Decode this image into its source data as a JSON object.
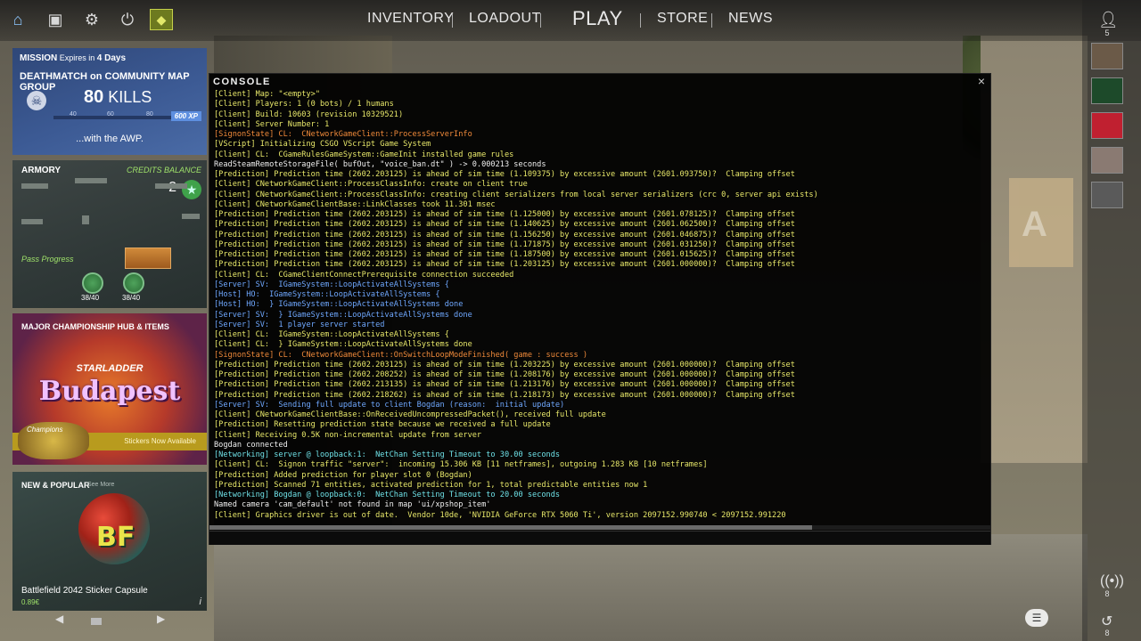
{
  "topbar": {
    "nav": [
      "INVENTORY",
      "LOADOUT",
      "PLAY",
      "STORE",
      "NEWS"
    ],
    "icons": [
      "home-icon",
      "briefcase-icon",
      "gear-icon",
      "power-icon",
      "rank-badge-icon"
    ]
  },
  "right_sidebar": {
    "friends_count": "5",
    "signal_count": "8",
    "history_count": "8"
  },
  "mission": {
    "label": "MISSION",
    "expires_prefix": "Expires in",
    "expires_value": "4 Days",
    "title": "DEATHMATCH on COMMUNITY MAP GROUP",
    "kills_number": "80",
    "kills_label": "KILLS",
    "ticks": [
      "40",
      "60",
      "80"
    ],
    "xp": "600 XP",
    "subtitle": "...with the AWP."
  },
  "armory": {
    "label": "ARMORY",
    "credits_label": "CREDITS BALANCE",
    "credits_value": "2",
    "pass_progress": "Pass Progress",
    "coin_counts": [
      "38/40",
      "38/40"
    ]
  },
  "major": {
    "label": "MAJOR CHAMPIONSHIP HUB & ITEMS",
    "brand": "STARLADDER",
    "city": "Budapest",
    "champions": "Champions",
    "stickers": "Stickers Now Available"
  },
  "popular": {
    "label": "NEW & POPULAR",
    "see_more": "See More",
    "item_art": "BF",
    "item_name": "Battlefield 2042 Sticker Capsule",
    "price": "0.89€"
  },
  "console": {
    "title": "CONSOLE",
    "close": "×",
    "lines": [
      {
        "c": "yellow",
        "t": "[Client] Map: \"<empty>\""
      },
      {
        "c": "yellow",
        "t": "[Client] Players: 1 (0 bots) / 1 humans"
      },
      {
        "c": "yellow",
        "t": "[Client] Build: 10603 (revision 10329521)"
      },
      {
        "c": "yellow",
        "t": "[Client] Server Number: 1"
      },
      {
        "c": "orange",
        "t": "[SignonState] CL:  CNetworkGameClient::ProcessServerInfo"
      },
      {
        "c": "yellow",
        "t": "[VScript] Initializing CSGO VScript Game System"
      },
      {
        "c": "yellow",
        "t": "[Client] CL:  CGameRulesGameSystem::GameInit installed game rules"
      },
      {
        "c": "white",
        "t": "ReadSteamRemoteStorageFile( bufOut, \"voice_ban.dt\" ) -> 0.000213 seconds"
      },
      {
        "c": "yellow",
        "t": "[Prediction] Prediction time (2602.203125) is ahead of sim time (1.109375) by excessive amount (2601.093750)?  Clamping offset"
      },
      {
        "c": "yellow",
        "t": "[Client] CNetworkGameClient::ProcessClassInfo: create on client true"
      },
      {
        "c": "yellow",
        "t": "[Client] CNetworkGameClient::ProcessClassInfo: creating client serializers from local server serializers (crc 0, server api exists)"
      },
      {
        "c": "yellow",
        "t": "[Client] CNetworkGameClientBase::LinkClasses took 11.301 msec"
      },
      {
        "c": "yellow",
        "t": "[Prediction] Prediction time (2602.203125) is ahead of sim time (1.125000) by excessive amount (2601.078125)?  Clamping offset"
      },
      {
        "c": "yellow",
        "t": "[Prediction] Prediction time (2602.203125) is ahead of sim time (1.140625) by excessive amount (2601.062500)?  Clamping offset"
      },
      {
        "c": "yellow",
        "t": "[Prediction] Prediction time (2602.203125) is ahead of sim time (1.156250) by excessive amount (2601.046875)?  Clamping offset"
      },
      {
        "c": "yellow",
        "t": "[Prediction] Prediction time (2602.203125) is ahead of sim time (1.171875) by excessive amount (2601.031250)?  Clamping offset"
      },
      {
        "c": "yellow",
        "t": "[Prediction] Prediction time (2602.203125) is ahead of sim time (1.187500) by excessive amount (2601.015625)?  Clamping offset"
      },
      {
        "c": "yellow",
        "t": "[Prediction] Prediction time (2602.203125) is ahead of sim time (1.203125) by excessive amount (2601.000000)?  Clamping offset"
      },
      {
        "c": "yellow",
        "t": "[Client] CL:  CGameClientConnectPrerequisite connection succeeded"
      },
      {
        "c": "blue",
        "t": "[Server] SV:  IGameSystem::LoopActivateAllSystems {"
      },
      {
        "c": "blue",
        "t": "[Host] HO:  IGameSystem::LoopActivateAllSystems {"
      },
      {
        "c": "blue",
        "t": "[Host] HO:  } IGameSystem::LoopActivateAllSystems done"
      },
      {
        "c": "blue",
        "t": "[Server] SV:  } IGameSystem::LoopActivateAllSystems done"
      },
      {
        "c": "blue",
        "t": "[Server] SV:  1 player server started"
      },
      {
        "c": "yellow",
        "t": "[Client] CL:  IGameSystem::LoopActivateAllSystems {"
      },
      {
        "c": "yellow",
        "t": "[Client] CL:  } IGameSystem::LoopActivateAllSystems done"
      },
      {
        "c": "orange",
        "t": "[SignonState] CL:  CNetworkGameClient::OnSwitchLoopModeFinished( game : success )"
      },
      {
        "c": "yellow",
        "t": "[Prediction] Prediction time (2602.203125) is ahead of sim time (1.203225) by excessive amount (2601.000000)?  Clamping offset"
      },
      {
        "c": "yellow",
        "t": "[Prediction] Prediction time (2602.208252) is ahead of sim time (1.208176) by excessive amount (2601.000000)?  Clamping offset"
      },
      {
        "c": "yellow",
        "t": "[Prediction] Prediction time (2602.213135) is ahead of sim time (1.213176) by excessive amount (2601.000000)?  Clamping offset"
      },
      {
        "c": "yellow",
        "t": "[Prediction] Prediction time (2602.218262) is ahead of sim time (1.218173) by excessive amount (2601.000000)?  Clamping offset"
      },
      {
        "c": "blue",
        "t": "[Server] SV:  Sending full update to client Bogdan (reason:  initial update)"
      },
      {
        "c": "yellow",
        "t": "[Client] CNetworkGameClientBase::OnReceivedUncompressedPacket(), received full update"
      },
      {
        "c": "yellow",
        "t": "[Prediction] Resetting prediction state because we received a full update"
      },
      {
        "c": "yellow",
        "t": "[Client] Receiving 0.5K non-incremental update from server"
      },
      {
        "c": "white",
        "t": "Bogdan connected"
      },
      {
        "c": "cyan",
        "t": "[Networking] server @ loopback:1:  NetChan Setting Timeout to 30.00 seconds"
      },
      {
        "c": "yellow",
        "t": "[Client] CL:  Signon traffic \"server\":  incoming 15.306 KB [11 netframes], outgoing 1.283 KB [10 netframes]"
      },
      {
        "c": "yellow",
        "t": "[Prediction] Added prediction for player slot 0 (Bogdan)"
      },
      {
        "c": "yellow",
        "t": "[Prediction] Scanned 71 entities, activated prediction for 1, total predictable entities now 1"
      },
      {
        "c": "cyan",
        "t": "[Networking] Bogdan @ loopback:0:  NetChan Setting Timeout to 20.00 seconds"
      },
      {
        "c": "white",
        "t": "Named camera 'cam_default' not found in map 'ui/xpshop_item'"
      },
      {
        "c": "yellow",
        "t": "[Client] Graphics driver is out of date.  Vendor 10de, 'NVIDIA GeForce RTX 5060 Ti', version 2097152.990740 < 2097152.991220"
      }
    ]
  },
  "colors": {
    "yellow": "#e8e86a",
    "white": "#f0f0f0",
    "orange": "#f08a3a",
    "blue": "#6fa8ff",
    "cyan": "#6ee0e6"
  }
}
